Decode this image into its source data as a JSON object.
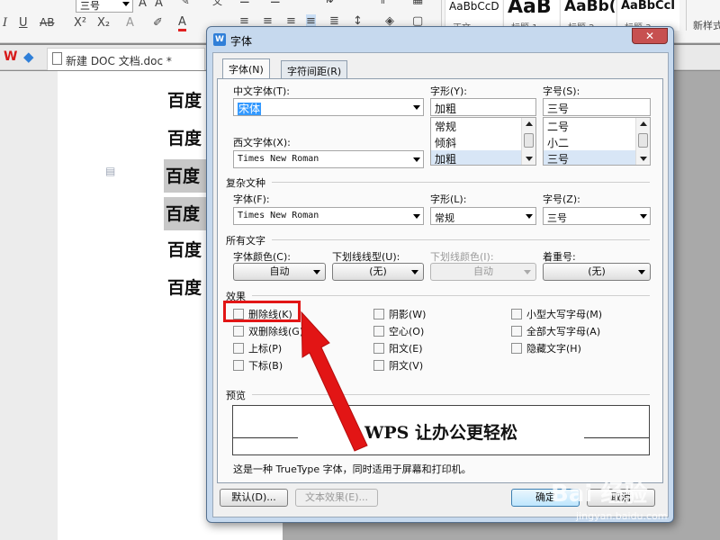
{
  "ribbon": {
    "font_size_value": "三号",
    "style_samples": [
      {
        "sample": "AaBbCcD",
        "name": "正文"
      },
      {
        "sample": "AaB",
        "name": "标题 1"
      },
      {
        "sample": "AaBb(",
        "name": "标题 2"
      },
      {
        "sample": "AaBbCcI",
        "name": "标题 3"
      }
    ],
    "new_style_label": "新样式"
  },
  "tabbar": {
    "doc_tab_label": "新建 DOC 文档.doc *"
  },
  "document": {
    "lines": [
      "百度",
      "百度",
      "百度",
      "百度",
      "百度",
      "百度"
    ]
  },
  "dialog": {
    "title": "字体",
    "close_symbol": "✕",
    "tabs": [
      "字体(N)",
      "字符间距(R)"
    ],
    "chinese_font": {
      "label": "中文字体(T):",
      "value": "宋体"
    },
    "western_font": {
      "label": "西文字体(X):",
      "value": "Times New Roman"
    },
    "font_style": {
      "label": "字形(Y):",
      "value": "加粗",
      "options": [
        "常规",
        "倾斜",
        "加粗"
      ]
    },
    "font_size": {
      "label": "字号(S):",
      "value": "三号",
      "options": [
        "二号",
        "小二",
        "三号"
      ]
    },
    "complex": {
      "group_label": "复杂文种",
      "font_label": "字体(F):",
      "font_value": "Times New Roman",
      "style_label": "字形(L):",
      "style_value": "常规",
      "size_label": "字号(Z):",
      "size_value": "三号"
    },
    "all_text": {
      "group_label": "所有文字",
      "color_label": "字体颜色(C):",
      "color_value": "自动",
      "underline_label": "下划线线型(U):",
      "underline_value": "(无)",
      "underline_color_label": "下划线颜色(I):",
      "underline_color_value": "自动",
      "emphasis_label": "着重号:",
      "emphasis_value": "(无)"
    },
    "effects": {
      "group_label": "效果",
      "col1": [
        "删除线(K)",
        "双删除线(G)",
        "上标(P)",
        "下标(B)"
      ],
      "col2": [
        "阴影(W)",
        "空心(O)",
        "阳文(E)",
        "阴文(V)"
      ],
      "col3": [
        "小型大写字母(M)",
        "全部大写字母(A)",
        "隐藏文字(H)"
      ]
    },
    "preview": {
      "group_label": "预览",
      "text": "WPS 让办公更轻松",
      "note": "这是一种 TrueType 字体，同时适用于屏幕和打印机。"
    },
    "buttons": {
      "default": "默认(D)...",
      "text_effects": "文本效果(E)...",
      "ok": "确定",
      "cancel": "取消"
    }
  },
  "watermark": {
    "logo": "Bai 经验",
    "url": "jingyan.baidu.com"
  },
  "colors": {
    "annotation_red": "#e21515",
    "dialog_frame": "#c6d9ee",
    "title_close": "#c75050"
  }
}
